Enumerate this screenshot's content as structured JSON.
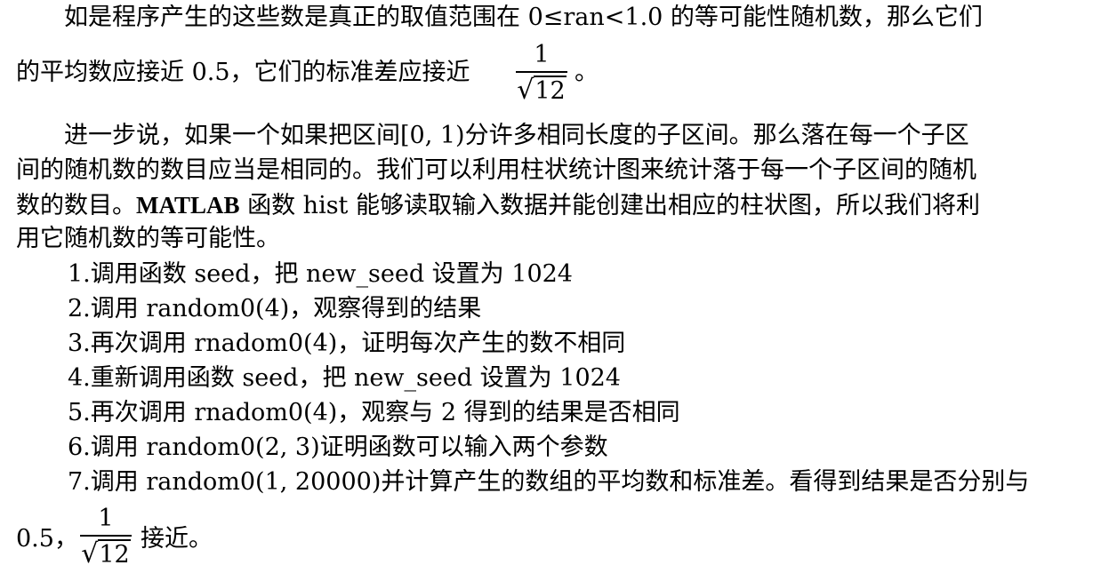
{
  "p1": {
    "line1": "如是程序产生的这些数是真正的取值范围在 0≤ran<1.0 的等可能性随机数，那么它们",
    "line2_pre": "的平均数应接近 0.5，它们的标准差应接近",
    "line2_post": "。",
    "frac_num": "1",
    "frac_sqrt": "√",
    "frac_radicand": "12"
  },
  "p2": {
    "line1": "进一步说，如果一个如果把区间[0, 1)分许多相同长度的子区间。那么落在每一个子区",
    "line2": "间的随机数的数目应当是相同的。我们可以利用柱状统计图来统计落于每一个子区间的随机",
    "line3_pre": "数的数目。",
    "line3_bold": "MATLAB",
    "line3_post": " 函数 hist 能够读取输入数据并能创建出相应的柱状图，所以我们将利",
    "line4": "用它随机数的等可能性。"
  },
  "steps": [
    "1.调用函数 seed，把 new_seed 设置为 1024",
    "2.调用 random0(4)，观察得到的结果",
    "3.再次调用 rnadom0(4)，证明每次产生的数不相同",
    "4.重新调用函数 seed，把 new_seed 设置为 1024",
    "5.再次调用 rnadom0(4)，观察与 2 得到的结果是否相同",
    "6.调用 random0(2, 3)证明函数可以输入两个参数",
    "7.调用 random0(1, 20000)并计算产生的数组的平均数和标准差。看得到结果是否分别与"
  ],
  "last": {
    "pre": "0.5，",
    "post": "接近。",
    "frac_num": "1",
    "frac_sqrt": "√",
    "frac_radicand": "12"
  }
}
